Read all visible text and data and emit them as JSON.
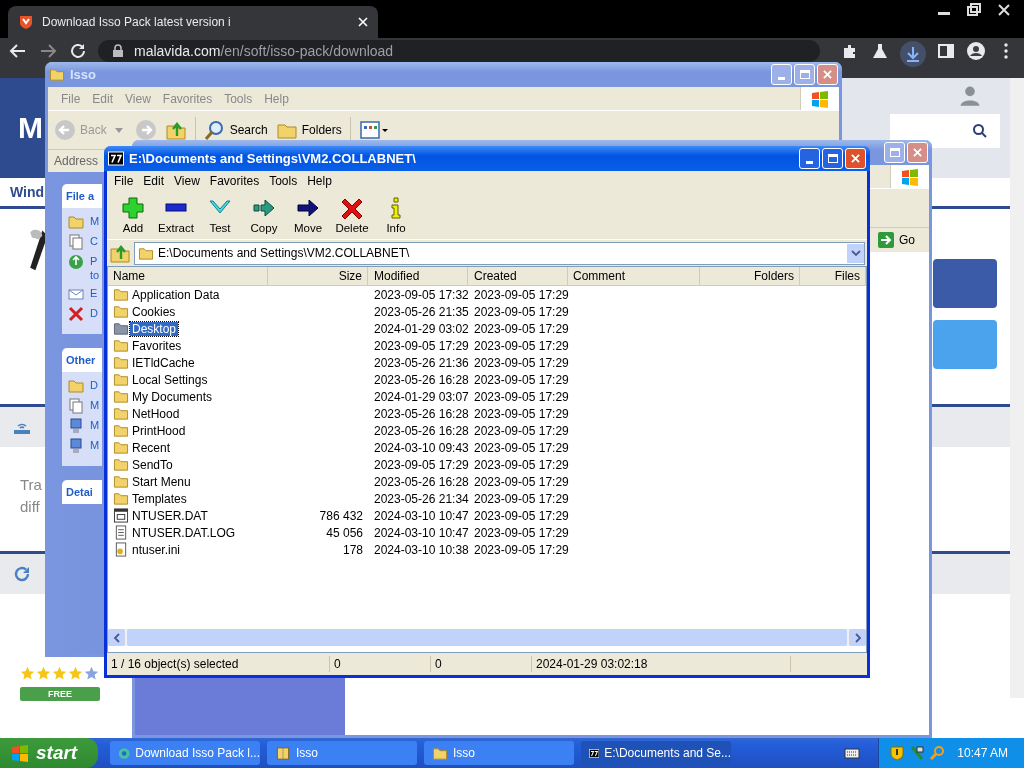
{
  "browser": {
    "tab_title": "Download Isso Pack latest version i",
    "url_host": "malavida.com",
    "url_path": "/en/soft/isso-pack/download"
  },
  "page": {
    "logo": "M",
    "nav": "Wind",
    "text_lines": [
      "Tra",
      "diff"
    ],
    "stars": 4,
    "badge": "FREE"
  },
  "explorer_back": {
    "title": "Isso",
    "menu": [
      "File",
      "Edit",
      "View",
      "Favorites",
      "Tools",
      "Help"
    ],
    "toolbar": [
      {
        "kind": "back",
        "label": "Back",
        "disabled": true
      },
      {
        "kind": "search",
        "label": "Search",
        "disabled": false
      },
      {
        "kind": "folders",
        "label": "Folders",
        "disabled": false
      }
    ],
    "address_label": "Address",
    "task_panels": [
      {
        "title": "File a",
        "items": [
          {
            "kind": "move",
            "label": "M"
          },
          {
            "kind": "copy",
            "label": "C"
          },
          {
            "kind": "publish",
            "label": "P to"
          },
          {
            "kind": "mail",
            "label": "E"
          },
          {
            "kind": "delete",
            "label": "D"
          }
        ]
      },
      {
        "title": "Other",
        "items": [
          {
            "kind": "folder",
            "label": "D"
          },
          {
            "kind": "documents",
            "label": "M"
          },
          {
            "kind": "computer",
            "label": "M"
          },
          {
            "kind": "network",
            "label": "M"
          }
        ]
      },
      {
        "title": "Detai"
      }
    ]
  },
  "explorer_front": {
    "go_label": "Go"
  },
  "archiver": {
    "title": "E:\\Documents and Settings\\VM2.COLLABNET\\",
    "menu": [
      "File",
      "Edit",
      "View",
      "Favorites",
      "Tools",
      "Help"
    ],
    "toolbar": [
      {
        "kind": "add",
        "label": "Add"
      },
      {
        "kind": "extract",
        "label": "Extract"
      },
      {
        "kind": "test",
        "label": "Test"
      },
      {
        "kind": "copy",
        "label": "Copy"
      },
      {
        "kind": "move",
        "label": "Move"
      },
      {
        "kind": "delete",
        "label": "Delete"
      },
      {
        "kind": "info",
        "label": "Info"
      }
    ],
    "path": "E:\\Documents and Settings\\VM2.COLLABNET\\",
    "columns": [
      "Name",
      "Size",
      "Modified",
      "Created",
      "Comment",
      "Folders",
      "Files"
    ],
    "rows": [
      {
        "kind": "folder",
        "name": "Application Data",
        "modified": "2023-09-05 17:32",
        "created": "2023-09-05 17:29",
        "selected": false
      },
      {
        "kind": "folder",
        "name": "Cookies",
        "modified": "2023-05-26 21:35",
        "created": "2023-09-05 17:29",
        "selected": false
      },
      {
        "kind": "folder",
        "name": "Desktop",
        "modified": "2024-01-29 03:02",
        "created": "2023-09-05 17:29",
        "selected": true
      },
      {
        "kind": "folder",
        "name": "Favorites",
        "modified": "2023-09-05 17:29",
        "created": "2023-09-05 17:29",
        "selected": false
      },
      {
        "kind": "folder",
        "name": "IETldCache",
        "modified": "2023-05-26 21:36",
        "created": "2023-09-05 17:29",
        "selected": false
      },
      {
        "kind": "folder",
        "name": "Local Settings",
        "modified": "2023-05-26 16:28",
        "created": "2023-09-05 17:29",
        "selected": false
      },
      {
        "kind": "folder",
        "name": "My Documents",
        "modified": "2024-01-29 03:07",
        "created": "2023-09-05 17:29",
        "selected": false
      },
      {
        "kind": "folder",
        "name": "NetHood",
        "modified": "2023-05-26 16:28",
        "created": "2023-09-05 17:29",
        "selected": false
      },
      {
        "kind": "folder",
        "name": "PrintHood",
        "modified": "2023-05-26 16:28",
        "created": "2023-09-05 17:29",
        "selected": false
      },
      {
        "kind": "folder",
        "name": "Recent",
        "modified": "2024-03-10 09:43",
        "created": "2023-09-05 17:29",
        "selected": false
      },
      {
        "kind": "folder",
        "name": "SendTo",
        "modified": "2023-09-05 17:29",
        "created": "2023-09-05 17:29",
        "selected": false
      },
      {
        "kind": "folder",
        "name": "Start Menu",
        "modified": "2023-05-26 16:28",
        "created": "2023-09-05 17:29",
        "selected": false
      },
      {
        "kind": "folder",
        "name": "Templates",
        "modified": "2023-05-26 21:34",
        "created": "2023-09-05 17:29",
        "selected": false
      },
      {
        "kind": "system",
        "name": "NTUSER.DAT",
        "size": "786 432",
        "modified": "2024-03-10 10:47",
        "created": "2023-09-05 17:29",
        "selected": false
      },
      {
        "kind": "text",
        "name": "NTUSER.DAT.LOG",
        "size": "45 056",
        "modified": "2024-03-10 10:47",
        "created": "2023-09-05 17:29",
        "selected": false
      },
      {
        "kind": "config",
        "name": "ntuser.ini",
        "size": "178",
        "modified": "2024-03-10 10:38",
        "created": "2023-09-05 17:29",
        "selected": false
      }
    ],
    "status": [
      "1 / 16 object(s) selected",
      "0",
      "0",
      "2024-01-29 03:02:18"
    ]
  },
  "taskbar": {
    "start": "start",
    "tasks": [
      {
        "kind": "browser",
        "label": "Download Isso Pack l...",
        "selected": false
      },
      {
        "kind": "zipfolder",
        "label": "Isso",
        "selected": false
      },
      {
        "kind": "folder",
        "label": "Isso",
        "selected": false
      },
      {
        "kind": "archiver",
        "label": "E:\\Documents and Se...",
        "selected": true
      }
    ],
    "clock": "10:47 AM"
  }
}
